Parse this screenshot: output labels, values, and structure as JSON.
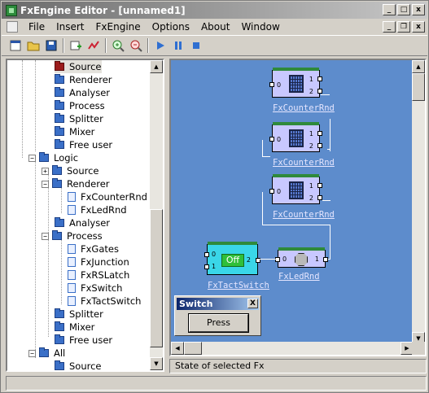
{
  "window": {
    "title": "FxEngine Editor - [unnamed1]"
  },
  "menu": {
    "items": [
      "File",
      "Insert",
      "FxEngine",
      "Options",
      "About",
      "Window"
    ]
  },
  "tree": {
    "rows": [
      {
        "label": "Source",
        "kind": "red",
        "selected": true
      },
      {
        "label": "Renderer",
        "kind": "folder"
      },
      {
        "label": "Analyser",
        "kind": "folder"
      },
      {
        "label": "Process",
        "kind": "folder"
      },
      {
        "label": "Splitter",
        "kind": "folder"
      },
      {
        "label": "Mixer",
        "kind": "folder"
      },
      {
        "label": "Free user",
        "kind": "folder"
      },
      {
        "label": "Logic",
        "kind": "folder",
        "expander": "−"
      },
      {
        "label": "Source",
        "kind": "folder",
        "expander": "+"
      },
      {
        "label": "Renderer",
        "kind": "folder",
        "expander": "−"
      },
      {
        "label": "FxCounterRnd",
        "kind": "doc"
      },
      {
        "label": "FxLedRnd",
        "kind": "doc"
      },
      {
        "label": "Analyser",
        "kind": "folder"
      },
      {
        "label": "Process",
        "kind": "folder",
        "expander": "−"
      },
      {
        "label": "FxGates",
        "kind": "doc"
      },
      {
        "label": "FxJunction",
        "kind": "doc"
      },
      {
        "label": "FxRSLatch",
        "kind": "doc"
      },
      {
        "label": "FxSwitch",
        "kind": "doc"
      },
      {
        "label": "FxTactSwitch",
        "kind": "doc"
      },
      {
        "label": "Splitter",
        "kind": "folder"
      },
      {
        "label": "Mixer",
        "kind": "folder"
      },
      {
        "label": "Free user",
        "kind": "folder"
      },
      {
        "label": "All",
        "kind": "folder",
        "expander": "−"
      },
      {
        "label": "Source",
        "kind": "folder"
      }
    ]
  },
  "canvas": {
    "counter_label": "FxCounterRnd",
    "tactswitch_label": "FxTactSwitch",
    "tactswitch_state": "Off",
    "led_label": "FxLedRnd",
    "pin_labels": {
      "p0": "0",
      "p1": "1",
      "p2": "2"
    }
  },
  "switch_window": {
    "title": "Switch",
    "close": "X",
    "button": "Press"
  },
  "status": {
    "selected_fx": "State of selected Fx"
  }
}
